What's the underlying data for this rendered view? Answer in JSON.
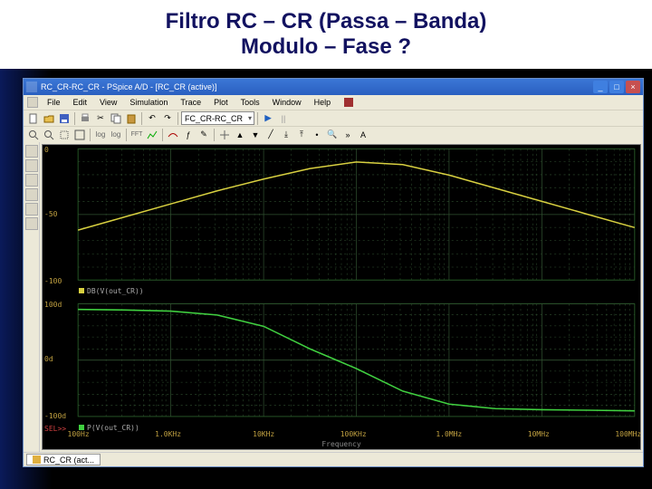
{
  "slide": {
    "title_line1": "Filtro RC – CR (Passa – Banda)",
    "title_line2": "Modulo – Fase ?"
  },
  "window": {
    "title": "RC_CR-RC_CR - PSpice A/D - [RC_CR (active)]"
  },
  "menubar": {
    "items": [
      "File",
      "Edit",
      "View",
      "Simulation",
      "Trace",
      "Plot",
      "Tools",
      "Window",
      "Help"
    ]
  },
  "toolbar": {
    "combo_schematic": "FC_CR-RC_CR",
    "play": "▶",
    "pause": "||"
  },
  "plot": {
    "top_trace_label": "DB(V(out_CR))",
    "top_trace_color": "#d8d040",
    "bot_trace_label": "P(V(out_CR))",
    "bot_trace_color": "#40d040",
    "sel_label": "SEL>>",
    "xaxis_title": "Frequency",
    "y_top_ticks": [
      "0",
      "-50",
      "-100"
    ],
    "y_bot_ticks": [
      "100d",
      "0d",
      "-100d"
    ],
    "x_ticks": [
      "100Hz",
      "1.0KHz",
      "10KHz",
      "100KHz",
      "1.0MHz",
      "10MHz",
      "100MHz"
    ]
  },
  "taskbar": {
    "tab_label": "RC_CR (act..."
  },
  "chart_data": [
    {
      "type": "line",
      "title": "Magnitude",
      "xlabel": "Frequency",
      "ylabel": "DB(V(out_CR))",
      "x_scale": "log",
      "ylim": [
        -100,
        0
      ],
      "x": [
        100,
        316,
        1000,
        3160,
        10000,
        31600,
        100000,
        316000,
        1000000,
        3160000,
        10000000,
        31600000,
        100000000
      ],
      "series": [
        {
          "name": "DB(V(out_CR))",
          "color": "#d8d040",
          "values": [
            -62,
            -52,
            -42,
            -32,
            -23,
            -15,
            -10,
            -12,
            -20,
            -30,
            -40,
            -50,
            -60
          ]
        }
      ]
    },
    {
      "type": "line",
      "title": "Phase",
      "xlabel": "Frequency",
      "ylabel": "P(V(out_CR)) (deg)",
      "x_scale": "log",
      "ylim": [
        -100,
        100
      ],
      "x": [
        100,
        316,
        1000,
        3160,
        10000,
        31600,
        100000,
        316000,
        1000000,
        3160000,
        10000000,
        31600000,
        100000000
      ],
      "series": [
        {
          "name": "P(V(out_CR))",
          "color": "#40d040",
          "values": [
            90,
            89,
            87,
            80,
            60,
            20,
            -15,
            -55,
            -78,
            -86,
            -88,
            -89,
            -90
          ]
        }
      ]
    }
  ]
}
